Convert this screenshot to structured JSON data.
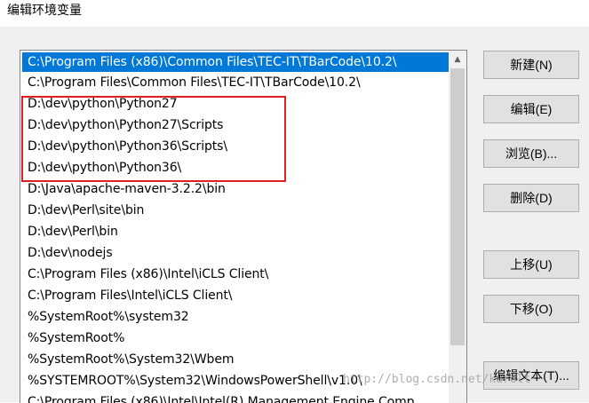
{
  "window": {
    "title": "编辑环境变量"
  },
  "list": {
    "items": [
      "C:\\Program Files (x86)\\Common Files\\TEC-IT\\TBarCode\\10.2\\",
      "C:\\Program Files\\Common Files\\TEC-IT\\TBarCode\\10.2\\",
      "D:\\dev\\python\\Python27",
      "D:\\dev\\python\\Python27\\Scripts",
      "D:\\dev\\python\\Python36\\Scripts\\",
      "D:\\dev\\python\\Python36\\",
      "D:\\Java\\apache-maven-3.2.2\\bin",
      "D:\\dev\\Perl\\site\\bin",
      "D:\\dev\\Perl\\bin",
      "D:\\dev\\nodejs",
      "C:\\Program Files (x86)\\Intel\\iCLS Client\\",
      "C:\\Program Files\\Intel\\iCLS Client\\",
      "%SystemRoot%\\system32",
      "%SystemRoot%",
      "%SystemRoot%\\System32\\Wbem",
      "%SYSTEMROOT%\\System32\\WindowsPowerShell\\v1.0\\",
      "C:\\Program Files (x86)\\Intel\\Intel(R) Management Engine Comp"
    ],
    "selected_index": 0
  },
  "buttons": {
    "new": "新建(N)",
    "edit": "编辑(E)",
    "browse": "浏览(B)...",
    "delete": "删除(D)",
    "move_up": "上移(U)",
    "move_down": "下移(O)",
    "edit_text": "编辑文本(T)..."
  },
  "watermark": "http://blog.csdn.net/kurolt",
  "colors": {
    "selection": "#0078d7",
    "annotation_box": "#e02020"
  }
}
